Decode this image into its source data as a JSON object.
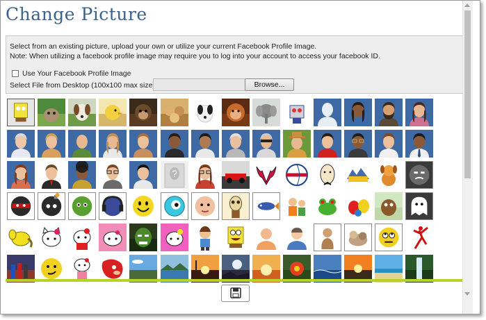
{
  "dialog": {
    "title": "Change Picture",
    "info_line1": "Select from an existing picture, upload your own or utilize your current Facebook Profile Image.",
    "info_line2": "Note: When utilizing a facebook profile image may require you to log into your account to access your facebook ID.",
    "use_facebook_label": "Use Your Facebook Profile Image",
    "use_facebook_checked": false,
    "file_label": "Select File from Desktop (100x100 max size):",
    "file_value": "",
    "browse_label": "Browse...",
    "save_icon": "floppy-disk-icon"
  },
  "colors": {
    "title": "#3d6188",
    "avatar_bg": "#3d6aa5",
    "accent_bar": "#b5d426"
  },
  "pictures": [
    {
      "name": "spongebob-icon",
      "kind": "yellow-sponge",
      "selected": true
    },
    {
      "name": "cat-icon",
      "kind": "cat"
    },
    {
      "name": "dog-icon",
      "kind": "dog"
    },
    {
      "name": "duckling-icon",
      "kind": "duck"
    },
    {
      "name": "monkey-icon",
      "kind": "monkey"
    },
    {
      "name": "puppies-icon",
      "kind": "puppies"
    },
    {
      "name": "spotted-puppy-icon",
      "kind": "spotted-dog"
    },
    {
      "name": "orangutan-icon",
      "kind": "orangutan"
    },
    {
      "name": "elephant-icon",
      "kind": "elephant"
    },
    {
      "name": "robot-icon",
      "kind": "robot"
    },
    {
      "name": "avatar-silhouette-icon",
      "kind": "avatar-silhouette"
    },
    {
      "name": "avatar-woman-dark-icon",
      "kind": "avatar-woman-dark"
    },
    {
      "name": "avatar-bearded-man-icon",
      "kind": "avatar-bearded"
    },
    {
      "name": "avatar-woman-icon",
      "kind": "avatar-woman"
    },
    {
      "name": "avatar-elder-woman-icon",
      "kind": "avatar-elder-woman"
    },
    {
      "name": "avatar-woman-blonde-icon",
      "kind": "avatar-woman-blonde"
    },
    {
      "name": "avatar-bald-man-icon",
      "kind": "avatar-bald"
    },
    {
      "name": "avatar-long-hair-icon",
      "kind": "avatar-long-hair"
    },
    {
      "name": "avatar-woman-short-icon",
      "kind": "avatar-woman-short"
    },
    {
      "name": "avatar-man-dark-icon",
      "kind": "avatar-man-dark"
    },
    {
      "name": "avatar-man-tan-icon",
      "kind": "avatar-man-tan"
    },
    {
      "name": "avatar-old-man-icon",
      "kind": "avatar-old-man"
    },
    {
      "name": "avatar-sunglasses-icon",
      "kind": "avatar-sunglasses"
    },
    {
      "name": "avatar-hat-icon",
      "kind": "avatar-hat"
    },
    {
      "name": "avatar-woman-red-icon",
      "kind": "avatar-woman-red"
    },
    {
      "name": "avatar-glasses-man-icon",
      "kind": "avatar-glasses"
    },
    {
      "name": "avatar-man-brown-icon",
      "kind": "avatar-man-brown"
    },
    {
      "name": "avatar-man-tie-icon",
      "kind": "avatar-man-tie"
    },
    {
      "name": "avatar-woman-auburn-icon",
      "kind": "avatar-woman-auburn"
    },
    {
      "name": "avatar-businessman-icon",
      "kind": "avatar-businessman"
    },
    {
      "name": "avatar-curly-woman-icon",
      "kind": "avatar-curly"
    },
    {
      "name": "avatar-geek-icon",
      "kind": "avatar-geek"
    },
    {
      "name": "avatar-woman-black-hair-icon",
      "kind": "avatar-woman-black"
    },
    {
      "name": "unknown-user-icon",
      "kind": "unknown"
    },
    {
      "name": "avatar-woman-glasses-icon",
      "kind": "avatar-woman-glasses"
    },
    {
      "name": "race-car-icon",
      "kind": "race-car"
    },
    {
      "name": "bulls-logo-icon",
      "kind": "bulls"
    },
    {
      "name": "clippers-logo-icon",
      "kind": "clippers"
    },
    {
      "name": "egghead-icon",
      "kind": "egghead"
    },
    {
      "name": "nuggets-logo-icon",
      "kind": "nuggets"
    },
    {
      "name": "cartoon-dog-icon",
      "kind": "cartoon-dog"
    },
    {
      "name": "angry-face-icon",
      "kind": "angry-face"
    },
    {
      "name": "ninja-ball-icon",
      "kind": "ninja-ball"
    },
    {
      "name": "bomb-icon",
      "kind": "bomb"
    },
    {
      "name": "clover-ball-icon",
      "kind": "clover-ball"
    },
    {
      "name": "headphones-ball-icon",
      "kind": "headphones"
    },
    {
      "name": "smiley-face-icon",
      "kind": "smiley"
    },
    {
      "name": "cyan-eye-icon",
      "kind": "cyan-eye"
    },
    {
      "name": "baby-face-icon",
      "kind": "baby"
    },
    {
      "name": "skeleton-icon",
      "kind": "skeleton"
    },
    {
      "name": "fish-icon",
      "kind": "fish"
    },
    {
      "name": "flintstones-icon",
      "kind": "flintstones"
    },
    {
      "name": "frog-icon",
      "kind": "frog"
    },
    {
      "name": "mms-icon",
      "kind": "mms"
    },
    {
      "name": "cartoon-cat-icon",
      "kind": "cartoon-cat"
    },
    {
      "name": "ghost-icon",
      "kind": "ghost"
    },
    {
      "name": "yellow-elephant-icon",
      "kind": "yellow-elephant"
    },
    {
      "name": "hello-kitty-icon",
      "kind": "hello-kitty"
    },
    {
      "name": "hello-kitty-red-icon",
      "kind": "hello-kitty-2"
    },
    {
      "name": "hello-kitty-pink-icon",
      "kind": "hello-kitty-pink"
    },
    {
      "name": "hulk-icon",
      "kind": "hulk"
    },
    {
      "name": "hello-kitty-colors-icon",
      "kind": "hello-kitty-colors"
    },
    {
      "name": "cartoon-boy-icon",
      "kind": "cartoon-boy"
    },
    {
      "name": "spongebob-laugh-icon",
      "kind": "spongebob"
    },
    {
      "name": "user-orange-icon",
      "kind": "user-orange"
    },
    {
      "name": "user-blue-icon",
      "kind": "user-blue"
    },
    {
      "name": "thinker-icon",
      "kind": "thinker"
    },
    {
      "name": "dog-toy-icon",
      "kind": "dog-toy"
    },
    {
      "name": "rolling-eyes-icon",
      "kind": "rolling-eyes"
    },
    {
      "name": "jumpman-logo-icon",
      "kind": "jumpman"
    },
    {
      "name": "superheroes-icon",
      "kind": "heroes"
    },
    {
      "name": "smirk-face-icon",
      "kind": "smirk"
    },
    {
      "name": "hello-kitty-small-icon",
      "kind": "hello-kitty-small"
    },
    {
      "name": "knuckles-icon",
      "kind": "knuckles"
    },
    {
      "name": "sky-landscape-icon",
      "kind": "sky"
    },
    {
      "name": "lake-landscape-icon",
      "kind": "lake"
    },
    {
      "name": "sunset-icon",
      "kind": "sunset"
    },
    {
      "name": "moon-icon",
      "kind": "moon"
    },
    {
      "name": "sunrise-icon",
      "kind": "sunrise"
    },
    {
      "name": "flower-icon",
      "kind": "flower"
    },
    {
      "name": "ocean-icon",
      "kind": "ocean"
    },
    {
      "name": "sunset-sea-icon",
      "kind": "sunset-sea"
    },
    {
      "name": "beach-icon",
      "kind": "beach"
    },
    {
      "name": "waterfall-icon",
      "kind": "waterfall"
    }
  ]
}
